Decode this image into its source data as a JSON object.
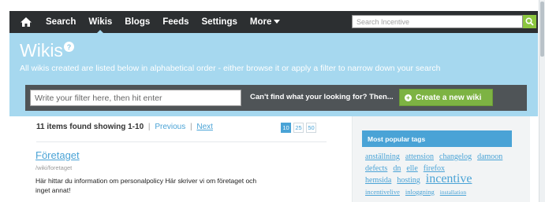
{
  "topnav": {
    "items": [
      {
        "label": "Search"
      },
      {
        "label": "Wikis"
      },
      {
        "label": "Blogs"
      },
      {
        "label": "Feeds"
      },
      {
        "label": "Settings"
      },
      {
        "label": "More"
      }
    ],
    "active": "Wikis",
    "search_placeholder": "Search Incentive"
  },
  "hero": {
    "title": "Wikis",
    "help": "?",
    "subtitle": "All wikis created are listed below in alphabetical order - either browse it or apply a filter to narrow down your search"
  },
  "filter": {
    "placeholder": "Write your filter here, then hit enter",
    "cant_find": "Can't find what your looking for? Then...",
    "create_label": "Create a new wiki"
  },
  "results": {
    "count_text": "11 items found showing 1-10",
    "previous": "Previous",
    "separator": "|",
    "next": "Next",
    "page_sizes": [
      "10",
      "25",
      "50"
    ],
    "active_size": "10"
  },
  "items": [
    {
      "title": "Företaget",
      "path": "/wiki/foretaget",
      "description": "Här hittar du information om personalpolicy Här skriver vi om företaget och inget annat!"
    }
  ],
  "tags": {
    "heading": "Most popular tags",
    "list": [
      {
        "label": "anställning",
        "size": "md"
      },
      {
        "label": "attension",
        "size": "md"
      },
      {
        "label": "changelog",
        "size": "md"
      },
      {
        "label": "damoon",
        "size": "md"
      },
      {
        "label": "defects",
        "size": "md"
      },
      {
        "label": "dn",
        "size": "md"
      },
      {
        "label": "elle",
        "size": "md"
      },
      {
        "label": "firefox",
        "size": "md"
      },
      {
        "label": "hemsida",
        "size": "md"
      },
      {
        "label": "hosting",
        "size": "md"
      },
      {
        "label": "incentive",
        "size": "xl"
      },
      {
        "label": "incentivelive",
        "size": "sm"
      },
      {
        "label": "inloggning",
        "size": "sm"
      },
      {
        "label": "installation",
        "size": "xs"
      }
    ]
  },
  "colors": {
    "nav_bg": "#2c2f31",
    "hero_bg": "#a6d8ef",
    "accent_green": "#7db343",
    "link_blue": "#4aa3d6"
  }
}
